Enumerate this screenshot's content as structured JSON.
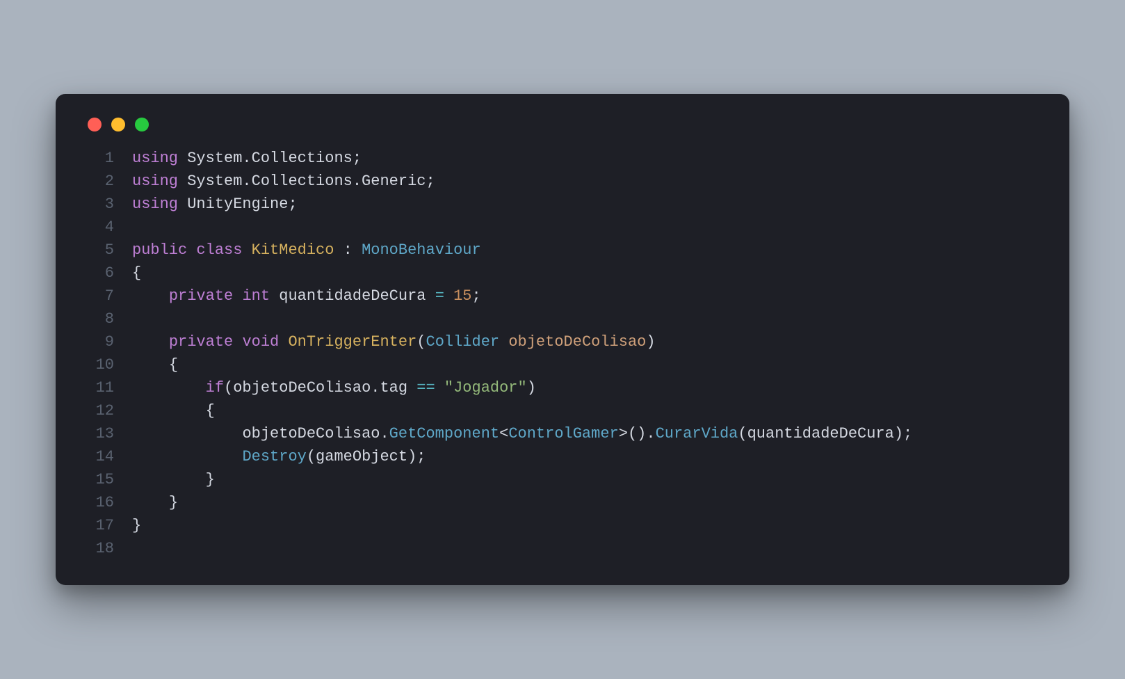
{
  "window": {
    "traffic": {
      "red": "#ff5f56",
      "yellow": "#ffbd2e",
      "green": "#27c93f"
    }
  },
  "code": {
    "line_numbers": [
      "1",
      "2",
      "3",
      "4",
      "5",
      "6",
      "7",
      "8",
      "9",
      "10",
      "11",
      "12",
      "13",
      "14",
      "15",
      "16",
      "17",
      "18"
    ],
    "lines": [
      {
        "html": "<span class='kw'>using</span> <span class='ns'>System.Collections;</span>"
      },
      {
        "html": "<span class='kw'>using</span> <span class='ns'>System.Collections.Generic;</span>"
      },
      {
        "html": "<span class='kw'>using</span> <span class='ns'>UnityEngine;</span>"
      },
      {
        "html": ""
      },
      {
        "html": "<span class='kw'>public</span> <span class='kw'>class</span> <span class='cls'>KitMedico</span> <span class='ns'>:</span> <span class='type'>MonoBehaviour</span>"
      },
      {
        "html": "<span class='ns'>{</span>"
      },
      {
        "html": "    <span class='kw'>private</span> <span class='kw'>int</span> <span class='ns'>quantidadeDeCura</span> <span class='op'>=</span> <span class='num2'>15</span><span class='ns'>;</span>"
      },
      {
        "html": ""
      },
      {
        "html": "    <span class='kw'>private</span> <span class='kw'>void</span> <span class='cls'>OnTriggerEnter</span><span class='ns'>(</span><span class='type'>Collider</span> <span class='id'>objetoDeColisao</span><span class='ns'>)</span>"
      },
      {
        "html": "    <span class='ns'>{</span>"
      },
      {
        "html": "        <span class='kw'>if</span><span class='ns'>(</span><span class='ns'>objetoDeColisao.tag</span> <span class='op'>==</span> <span class='str'>\"Jogador\"</span><span class='ns'>)</span>"
      },
      {
        "html": "        <span class='ns'>{</span>"
      },
      {
        "html": "            <span class='ns'>objetoDeColisao.</span><span class='call'>GetComponent</span><span class='ns'>&lt;</span><span class='type'>ControlGamer</span><span class='ns'>&gt;().</span><span class='call'>CurarVida</span><span class='ns'>(quantidadeDeCura);</span>"
      },
      {
        "html": "            <span class='call'>Destroy</span><span class='ns'>(gameObject);</span>"
      },
      {
        "html": "        <span class='ns'>}</span>"
      },
      {
        "html": "    <span class='ns'>}</span>"
      },
      {
        "html": "<span class='ns'>}</span>"
      },
      {
        "html": ""
      }
    ]
  }
}
